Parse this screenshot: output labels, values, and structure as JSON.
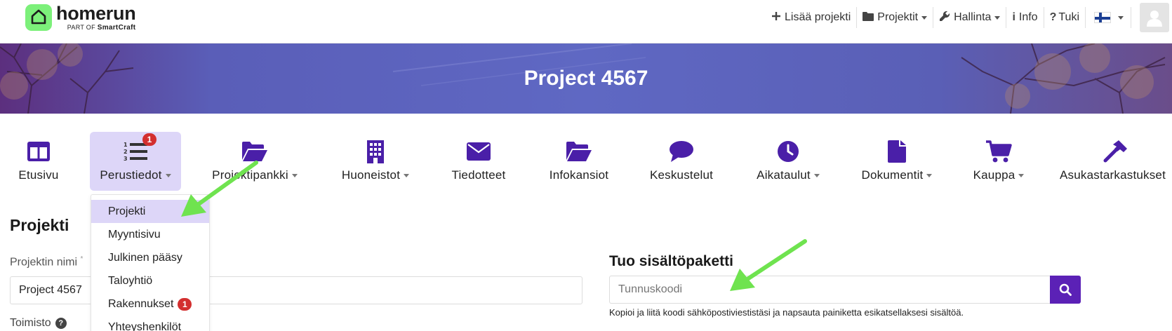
{
  "app": {
    "logo_name": "homerun",
    "logo_sub_prefix": "PART OF",
    "logo_sub_brand": "SmartCraft"
  },
  "topnav": {
    "add_project": "Lisää projekti",
    "projects": "Projektit",
    "admin": "Hallinta",
    "info": "Info",
    "support": "Tuki"
  },
  "banner": {
    "title": "Project 4567"
  },
  "modules": [
    {
      "label": "Etusivu",
      "icon": "columns-icon",
      "has_caret": false
    },
    {
      "label": "Perustiedot",
      "icon": "list-ol-icon",
      "has_caret": true,
      "badge": "1",
      "active": true
    },
    {
      "label": "Projektipankki",
      "icon": "folder-open-icon",
      "has_caret": true
    },
    {
      "label": "Huoneistot",
      "icon": "building-icon",
      "has_caret": true
    },
    {
      "label": "Tiedotteet",
      "icon": "envelope-icon",
      "has_caret": false
    },
    {
      "label": "Infokansiot",
      "icon": "folder-open-icon",
      "has_caret": false
    },
    {
      "label": "Keskustelut",
      "icon": "comment-icon",
      "has_caret": false
    },
    {
      "label": "Aikataulut",
      "icon": "clock-icon",
      "has_caret": true
    },
    {
      "label": "Dokumentit",
      "icon": "file-icon",
      "has_caret": true
    },
    {
      "label": "Kauppa",
      "icon": "cart-icon",
      "has_caret": true
    },
    {
      "label": "Asukastarkastukset",
      "icon": "hammer-icon",
      "has_caret": false
    }
  ],
  "dropdown": {
    "items": [
      {
        "label": "Projekti",
        "active": true
      },
      {
        "label": "Myyntisivu"
      },
      {
        "label": "Julkinen pääsy"
      },
      {
        "label": "Taloyhtiö"
      },
      {
        "label": "Rakennukset",
        "badge": "1"
      },
      {
        "label": "Yhteyshenkilöt"
      }
    ]
  },
  "form": {
    "heading": "Projekti",
    "name_label": "Projektin nimi",
    "name_required": "*",
    "name_value": "Project 4567",
    "office_label": "Toimisto"
  },
  "import": {
    "title": "Tuo sisältöpaketti",
    "placeholder": "Tunnuskoodi",
    "help": "Kopioi ja liitä koodi sähköpostiviestistäsi ja napsauta painiketta esikatsellaksesi sisältöä."
  },
  "colors": {
    "accent": "#5b21b6",
    "icon": "#4a1fa8",
    "active_bg": "#ddd6f8",
    "badge": "#d32f2f",
    "annotation_arrow": "#6fe34f"
  }
}
